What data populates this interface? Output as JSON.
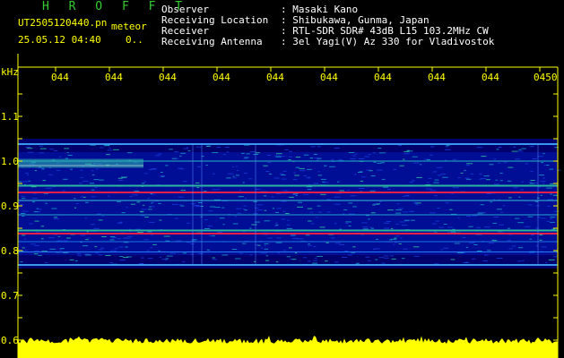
{
  "header": {
    "app_title": "H R O F F T",
    "filename": "UT2505120440.pn",
    "mode": "meteor",
    "datetime": "25.05.12 04:40",
    "page_marker": "0..",
    "fields": [
      {
        "label": "Observer",
        "value": ": Masaki Kano"
      },
      {
        "label": "Receiving Location",
        "value": ": Shibukawa, Gunma, Japan"
      },
      {
        "label": "Receiver",
        "value": ": RTL-SDR SDR# 43dB L15 103.2MHz CW"
      },
      {
        "label": "Receiving Antenna",
        "value": ": 3el Yagi(V) Az 330 for Vladivostok"
      }
    ]
  },
  "plot": {
    "y_unit": "kHz",
    "y_ticks": [
      "1.1",
      "1.0",
      "0.9",
      "0.8",
      "0.7",
      "0.6"
    ],
    "time_ticks": [
      "044",
      "044",
      "044",
      "044",
      "044",
      "044",
      "044",
      "044",
      "044",
      "0450"
    ],
    "colors": {
      "axis": "#ffff00",
      "background": "#000080",
      "signal_strong": "#ff2040",
      "signal_mid": "#30c8a0"
    }
  }
}
